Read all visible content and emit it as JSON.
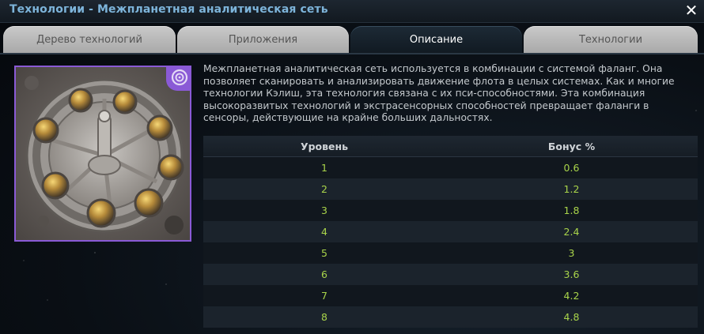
{
  "window": {
    "title": "Технологии - Межпланетная аналитическая сеть",
    "close_icon": "close-icon",
    "close_glyph": "✕"
  },
  "tabs": [
    {
      "label": "Дерево технологий",
      "active": false
    },
    {
      "label": "Приложения",
      "active": false
    },
    {
      "label": "Описание",
      "active": true
    },
    {
      "label": "Технологии",
      "active": false
    }
  ],
  "tech_image": {
    "badge_icon": "psi-swirl-icon",
    "frame_color": "#8a5ad6"
  },
  "description": "Межпланетная аналитическая сеть используется в комбинации с системой фаланг. Она позволяет сканировать и анализировать движение флота в целых системах. Как и многие технологии Кэлиш, эта технология связана с их пси-способностями. Эта комбинация высокоразвитых технологий и экстрасенсорных способностей превращает фаланги в сенсоры, действующие на крайне больших дальностях.",
  "table": {
    "headers": {
      "level": "Уровень",
      "bonus": "Бонус %"
    },
    "rows": [
      {
        "level": "1",
        "bonus": "0.6"
      },
      {
        "level": "2",
        "bonus": "1.2"
      },
      {
        "level": "3",
        "bonus": "1.8"
      },
      {
        "level": "4",
        "bonus": "2.4"
      },
      {
        "level": "5",
        "bonus": "3"
      },
      {
        "level": "6",
        "bonus": "3.6"
      },
      {
        "level": "7",
        "bonus": "4.2"
      },
      {
        "level": "8",
        "bonus": "4.8"
      }
    ]
  },
  "colors": {
    "title": "#7db4da",
    "value": "#a9d44a",
    "tab_inactive": "#c9c9c9",
    "tab_active": "#1d2a36"
  }
}
